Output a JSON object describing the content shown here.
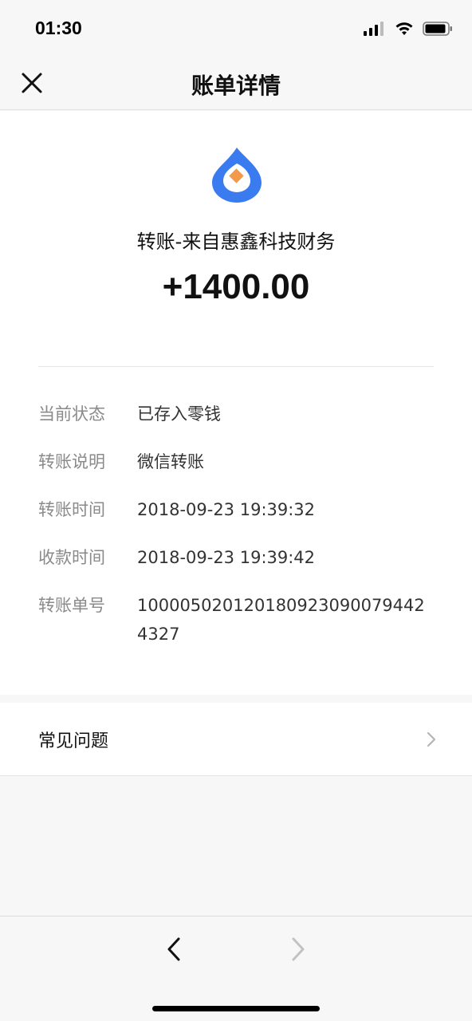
{
  "status_bar": {
    "time": "01:30",
    "icons": [
      "cellular-signal-icon",
      "wifi-icon",
      "battery-icon"
    ]
  },
  "nav": {
    "title": "账单详情",
    "close_icon": "close-icon"
  },
  "transaction": {
    "logo_icon": "wechat-pay-change-icon",
    "sender": "转账-来自惠鑫科技财务",
    "amount": "+1400.00"
  },
  "details": [
    {
      "label": "当前状态",
      "value": "已存入零钱"
    },
    {
      "label": "转账说明",
      "value": "微信转账"
    },
    {
      "label": "转账时间",
      "value": "2018-09-23 19:39:32"
    },
    {
      "label": "收款时间",
      "value": "2018-09-23 19:39:42"
    },
    {
      "label": "转账单号",
      "value": "1000050201201809230900794424327"
    }
  ],
  "faq": {
    "label": "常见问题",
    "icon": "chevron-right-icon"
  },
  "bottom_nav": {
    "back_icon": "back-arrow-icon",
    "forward_icon": "forward-arrow-icon"
  },
  "colors": {
    "accent_blue": "#3a7cf0",
    "accent_orange": "#f29a4a",
    "label_gray": "#8a8a8a",
    "background": "#f7f7f7"
  }
}
